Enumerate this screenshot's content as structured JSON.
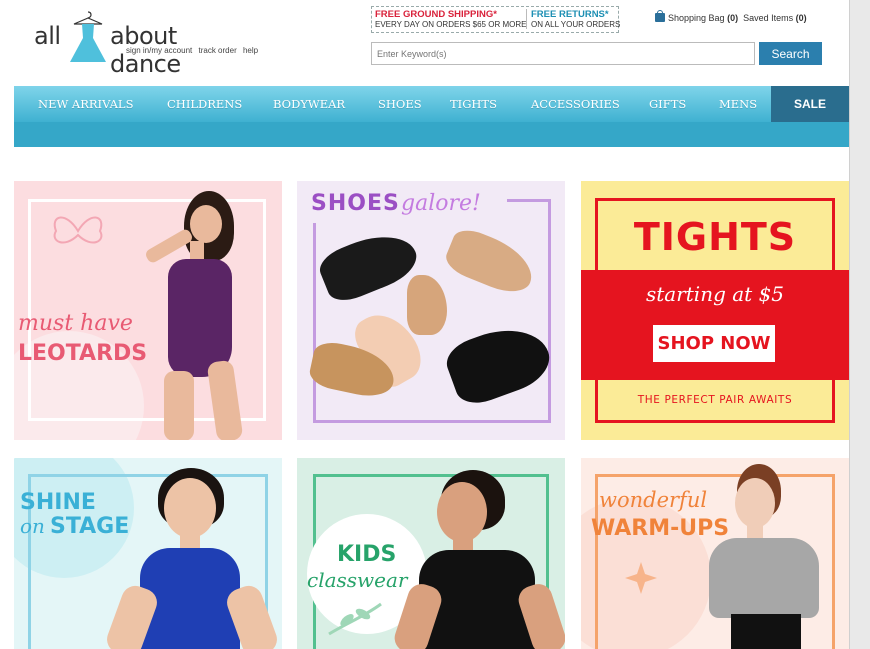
{
  "header": {
    "logo": {
      "part1": "all",
      "part2": "about dance"
    },
    "account_links": [
      "sign in/my account",
      "track order",
      "help"
    ],
    "promo": {
      "shipping_title": "FREE GROUND SHIPPING*",
      "shipping_sub": "EVERY DAY ON ORDERS $65 OR MORE",
      "returns_title": "FREE RETURNS*",
      "returns_sub": "ON ALL YOUR ORDERS"
    },
    "bag": {
      "shopping_bag_label": "Shopping Bag",
      "shopping_bag_count": "(0)",
      "saved_items_label": "Saved Items",
      "saved_items_count": "(0)"
    },
    "search": {
      "placeholder": "Enter Keyword(s)",
      "button_label": "Search"
    }
  },
  "nav": {
    "items": [
      "NEW ARRIVALS",
      "CHILDRENS",
      "BODYWEAR",
      "SHOES",
      "TIGHTS",
      "ACCESSORIES",
      "GIFTS",
      "MENS"
    ],
    "sale_label": "SALE"
  },
  "tiles": {
    "leotards": {
      "line1": "must have",
      "line2": "LEOTARDS"
    },
    "shoes": {
      "word1": "SHOES",
      "word2": "galore!"
    },
    "tights": {
      "title": "TIGHTS",
      "starting": "starting at $5",
      "cta": "SHOP NOW",
      "tagline": "THE PERFECT PAIR AWAITS"
    },
    "stage": {
      "line1": "SHINE",
      "line2a": "on",
      "line2b": "STAGE"
    },
    "kids": {
      "line1": "KIDS",
      "line2": "classwear"
    },
    "warmups": {
      "line1": "wonderful",
      "line2": "WARM-UPS"
    }
  },
  "colors": {
    "nav_blue": "#3fb1d1",
    "sale_navy": "#2a6d8e",
    "tights_red": "#e5141f",
    "leotard_pink": "#e85a73",
    "shoes_purple": "#9b4fc4",
    "stage_blue": "#3ab0d6",
    "kids_green": "#27a36a",
    "warmups_orange": "#f0833a"
  }
}
